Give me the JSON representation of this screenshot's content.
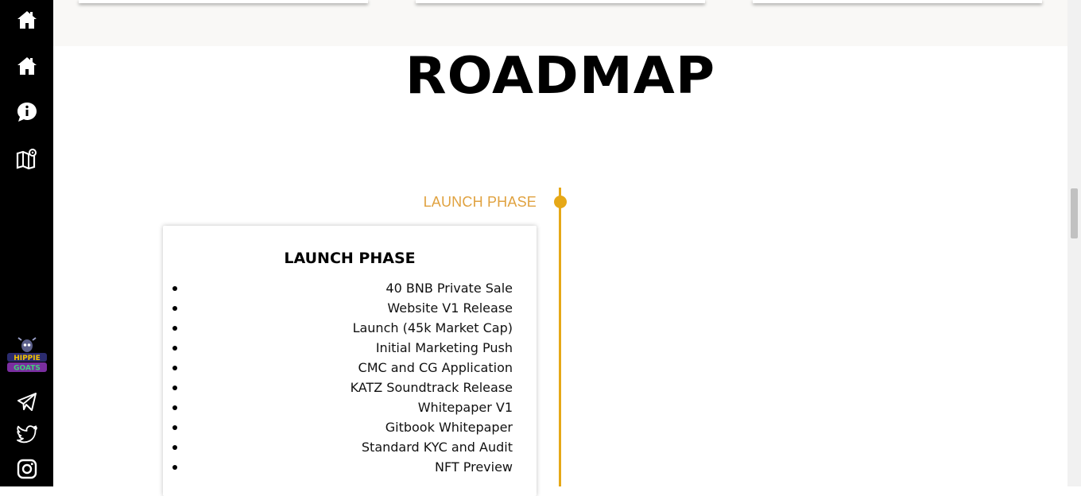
{
  "sidebar": {
    "nav": [
      {
        "icon": "home-icon"
      },
      {
        "icon": "home-icon"
      },
      {
        "icon": "info-chat-icon"
      },
      {
        "icon": "map-icon"
      }
    ],
    "logo": {
      "alt": "HIPPIE GOATS"
    },
    "social": [
      {
        "icon": "telegram-icon"
      },
      {
        "icon": "twitter-icon"
      },
      {
        "icon": "instagram-icon"
      }
    ]
  },
  "colors": {
    "accent": "#e6a817",
    "phase_label": "#e0a240",
    "sidebar": "#000000"
  },
  "roadmap": {
    "title": "ROADMAP",
    "phase_label": "LAUNCH PHASE",
    "card": {
      "title": "LAUNCH PHASE",
      "items": [
        "40 BNB Private Sale",
        "Website V1 Release",
        "Launch (45k Market Cap)",
        "Initial Marketing Push",
        "CMC and CG Application",
        "KATZ Soundtrack Release",
        "Whitepaper V1",
        "Gitbook Whitepaper",
        "Standard KYC and Audit",
        "NFT Preview"
      ]
    }
  }
}
